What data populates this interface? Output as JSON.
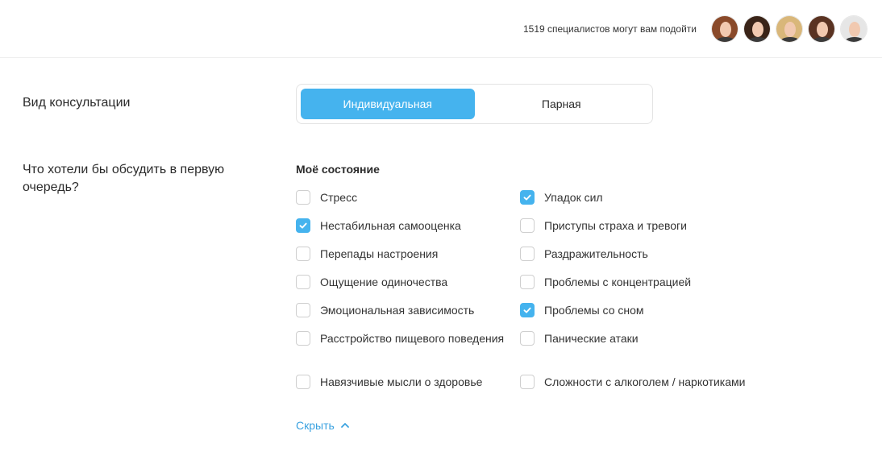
{
  "header": {
    "specialists_text": "1519 специалистов могут вам подойти",
    "avatars": [
      {
        "name": "specialist-avatar",
        "hair": "#8a4a2a"
      },
      {
        "name": "specialist-avatar",
        "hair": "#3a2418"
      },
      {
        "name": "specialist-avatar",
        "hair": "#d9b77a"
      },
      {
        "name": "specialist-avatar",
        "hair": "#5a3322"
      },
      {
        "name": "specialist-avatar",
        "hair": "#e6e6e6"
      }
    ]
  },
  "consultation": {
    "label": "Вид консультации",
    "options": [
      "Индивидуальная",
      "Парная"
    ],
    "selected": "Индивидуальная"
  },
  "discuss": {
    "label": "Что хотели бы обсудить в первую очередь?",
    "section_title": "Моё состояние",
    "left_column": [
      {
        "label": "Стресс",
        "checked": false
      },
      {
        "label": "Нестабильная самооценка",
        "checked": true
      },
      {
        "label": "Перепады настроения",
        "checked": false
      },
      {
        "label": "Ощущение одиночества",
        "checked": false
      },
      {
        "label": "Эмоциональная зависимость",
        "checked": false
      },
      {
        "label": "Расстройство пищевого поведения",
        "checked": false
      },
      {
        "label": "Навязчивые мысли о здоровье",
        "checked": false
      }
    ],
    "right_column": [
      {
        "label": "Упадок сил",
        "checked": true
      },
      {
        "label": "Приступы страха и тревоги",
        "checked": false
      },
      {
        "label": "Раздражительность",
        "checked": false
      },
      {
        "label": "Проблемы с концентрацией",
        "checked": false
      },
      {
        "label": "Проблемы со сном",
        "checked": true
      },
      {
        "label": "Панические атаки",
        "checked": false
      },
      {
        "label": "Сложности с алкоголем / наркотиками",
        "checked": false
      }
    ],
    "hide_label": "Скрыть"
  },
  "colors": {
    "accent": "#45b3ee",
    "link": "#3aa2e0"
  }
}
